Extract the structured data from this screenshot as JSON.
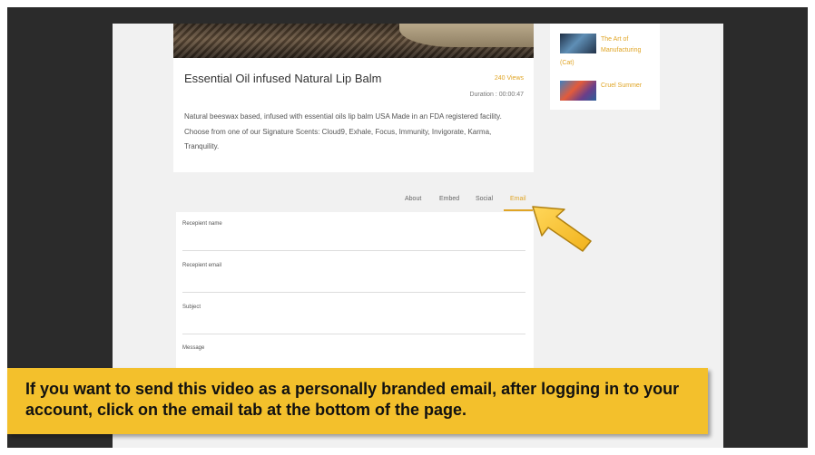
{
  "video": {
    "title": "Essential Oil infused Natural Lip Balm",
    "views": "240 Views",
    "duration": "Duration : 00:00:47",
    "description": "Natural beeswax based, infused with essential oils lip balm USA Made in an FDA registered facility. Choose from one of our Signature Scents: Cloud9, Exhale, Focus, Immunity, Invigorate, Karma, Tranquility."
  },
  "tabs": [
    {
      "label": "About"
    },
    {
      "label": "Embed"
    },
    {
      "label": "Social"
    },
    {
      "label": "Email",
      "active": true
    }
  ],
  "form": {
    "recipient_name_label": "Recepient name",
    "recipient_email_label": "Recepient email",
    "subject_label": "Subject",
    "message_label": "Message"
  },
  "sidebar": {
    "items": [
      {
        "title_line1": "The Art of",
        "title_line2": "Manufacturing",
        "title_line3": "(Cat)"
      },
      {
        "title": "Cruel Summer"
      }
    ]
  },
  "banner": {
    "text": "If you want to send this video as a personally branded email, after logging in to your account, click on the email tab at the bottom of the page."
  },
  "colors": {
    "accent": "#e0a526",
    "banner": "#f3c02c",
    "background": "#2b2b2b"
  },
  "icons": {
    "pointer": "arrow-pointer-icon"
  }
}
